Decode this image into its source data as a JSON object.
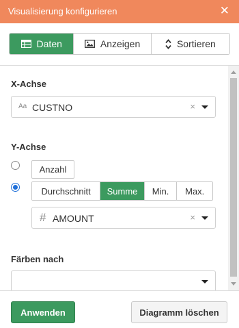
{
  "window": {
    "title": "Visualisierung konfigurieren",
    "close_glyph": "✕"
  },
  "tabs": [
    {
      "label": "Daten",
      "icon": "table-icon",
      "active": true
    },
    {
      "label": "Anzeigen",
      "icon": "image-icon",
      "active": false
    },
    {
      "label": "Sortieren",
      "icon": "sort-icon",
      "active": false
    }
  ],
  "x_axis": {
    "label": "X-Achse",
    "type_icon": "Aa",
    "value": "CUSTNO",
    "clear_glyph": "×"
  },
  "y_axis": {
    "label": "Y-Achse",
    "count_option": {
      "label": "Anzahl",
      "selected": false
    },
    "aggregate_option": {
      "selected": true
    },
    "aggregations": [
      {
        "label": "Durchschnitt",
        "active": false
      },
      {
        "label": "Summe",
        "active": true
      },
      {
        "label": "Min.",
        "active": false
      },
      {
        "label": "Max.",
        "active": false
      }
    ],
    "field": {
      "type_icon": "#",
      "value": "AMOUNT",
      "clear_glyph": "×"
    }
  },
  "color_by": {
    "label": "Färben nach",
    "value": ""
  },
  "footer": {
    "apply_label": "Anwenden",
    "delete_label": "Diagramm löschen"
  },
  "colors": {
    "header": "#f0885c",
    "accent": "#3c9a5f",
    "radio": "#1e6fd9"
  }
}
